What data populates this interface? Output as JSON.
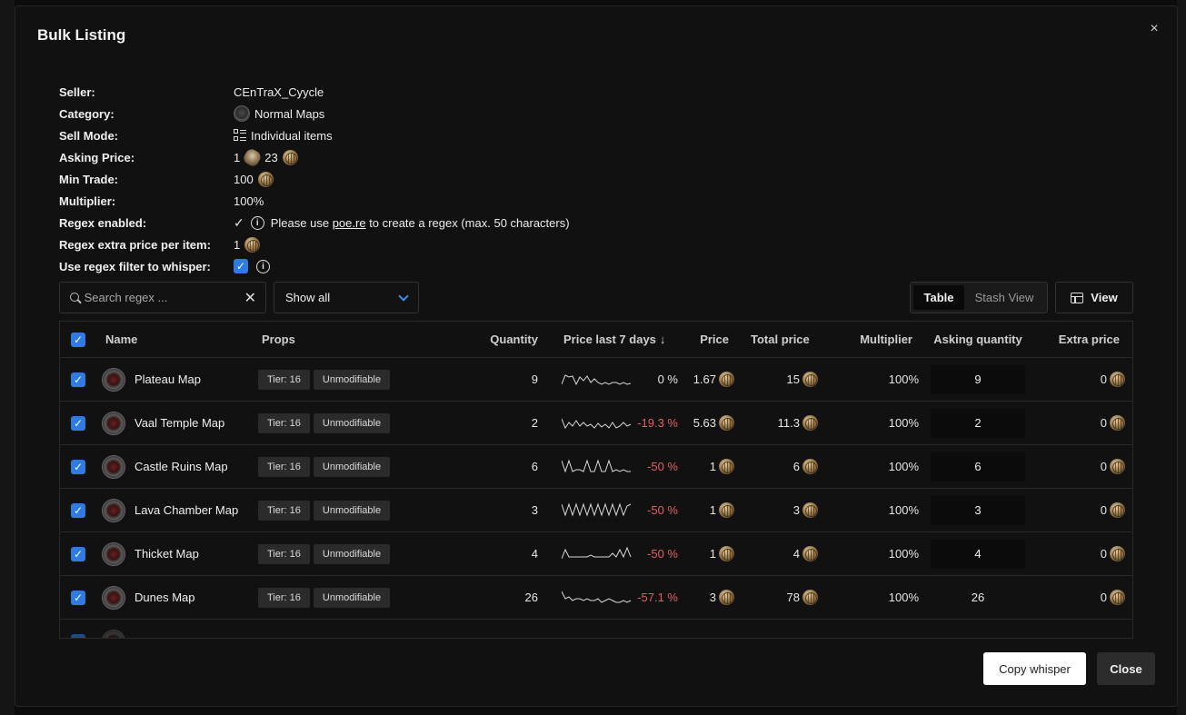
{
  "modal": {
    "title": "Bulk Listing",
    "close_icon": "×"
  },
  "info": {
    "seller": {
      "label": "Seller:",
      "value": "CEnTraX_Cyycle"
    },
    "category": {
      "label": "Category:",
      "value": "Normal Maps"
    },
    "sell_mode": {
      "label": "Sell Mode:",
      "value": "Individual items"
    },
    "asking_price": {
      "label": "Asking Price:",
      "divine": "1",
      "chaos": "23"
    },
    "min_trade": {
      "label": "Min Trade:",
      "value": "100"
    },
    "multiplier": {
      "label": "Multiplier:",
      "value": "100%"
    },
    "regex_enabled": {
      "label": "Regex enabled:",
      "check": "✓",
      "text_pre": "Please use",
      "link": "poe.re",
      "text_post": "to create a regex (max. 50 characters)"
    },
    "regex_extra": {
      "label": "Regex extra price per item:",
      "value": "1"
    },
    "use_regex": {
      "label": "Use regex filter to whisper:",
      "checked": true
    }
  },
  "toolbar": {
    "search_placeholder": "Search regex ...",
    "clear_icon": "✕",
    "filter_value": "Show all",
    "view_table": "Table",
    "view_stash": "Stash View",
    "view_button": "View"
  },
  "table": {
    "headers": {
      "name": "Name",
      "props": "Props",
      "quantity": "Quantity",
      "price7": "Price last 7 days",
      "price": "Price",
      "total": "Total price",
      "multiplier": "Multiplier",
      "asking": "Asking quantity",
      "extra": "Extra price"
    },
    "rows": [
      {
        "name": "Plateau Map",
        "tags": [
          "Tier: 16",
          "Unmodifiable"
        ],
        "quantity": "9",
        "change": "0 %",
        "price": "1.67",
        "total": "15",
        "multiplier": "100%",
        "asking": "9",
        "extra": "0"
      },
      {
        "name": "Vaal Temple Map",
        "tags": [
          "Tier: 16",
          "Unmodifiable"
        ],
        "quantity": "2",
        "change": "-19.3 %",
        "price": "5.63",
        "total": "11.3",
        "multiplier": "100%",
        "asking": "2",
        "extra": "0"
      },
      {
        "name": "Castle Ruins Map",
        "tags": [
          "Tier: 16",
          "Unmodifiable"
        ],
        "quantity": "6",
        "change": "-50 %",
        "price": "1",
        "total": "6",
        "multiplier": "100%",
        "asking": "6",
        "extra": "0"
      },
      {
        "name": "Lava Chamber Map",
        "tags": [
          "Tier: 16",
          "Unmodifiable"
        ],
        "quantity": "3",
        "change": "-50 %",
        "price": "1",
        "total": "3",
        "multiplier": "100%",
        "asking": "3",
        "extra": "0"
      },
      {
        "name": "Thicket Map",
        "tags": [
          "Tier: 16",
          "Unmodifiable"
        ],
        "quantity": "4",
        "change": "-50 %",
        "price": "1",
        "total": "4",
        "multiplier": "100%",
        "asking": "4",
        "extra": "0"
      },
      {
        "name": "Dunes Map",
        "tags": [
          "Tier: 16",
          "Unmodifiable"
        ],
        "quantity": "26",
        "change": "-57.1 %",
        "price": "3",
        "total": "78",
        "multiplier": "100%",
        "asking": "26",
        "extra": "0"
      }
    ]
  },
  "footer": {
    "copy_whisper": "Copy whisper",
    "close": "Close"
  },
  "colors": {
    "accent": "#2f7be0",
    "negative": "#e06060",
    "background": "#111111"
  }
}
